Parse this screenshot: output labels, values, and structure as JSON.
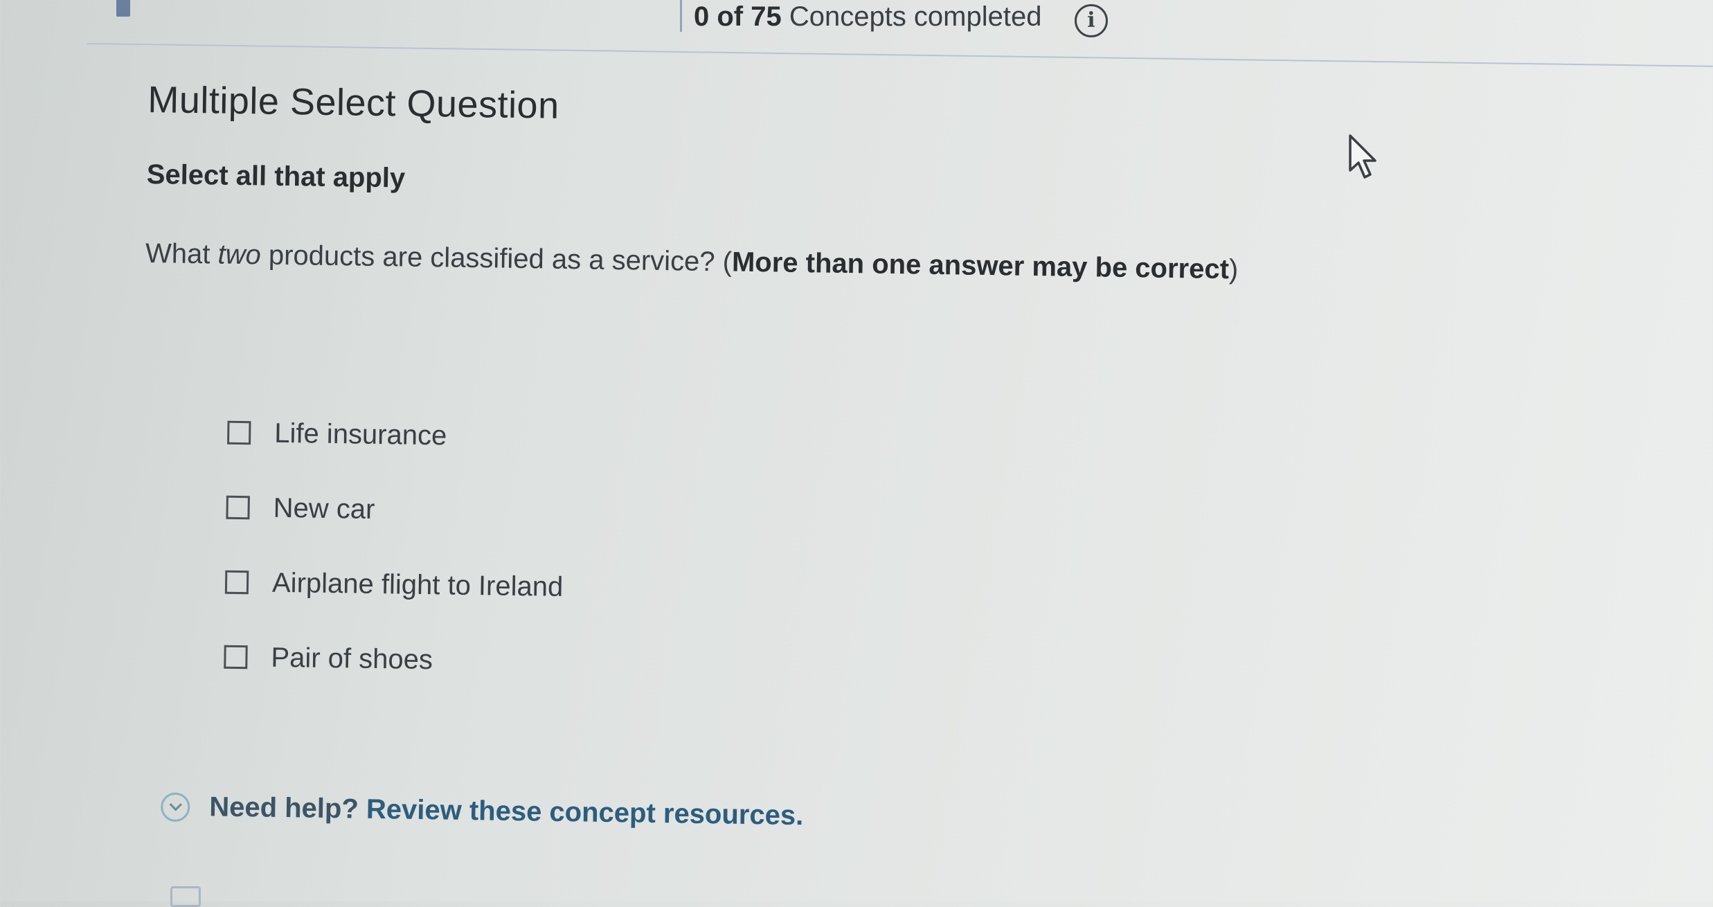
{
  "header": {
    "progress_count": "0 of 75",
    "progress_suffix": " Concepts completed",
    "info_icon_glyph": "i"
  },
  "question": {
    "type_label": "Multiple Select Question",
    "instruction": "Select all that apply",
    "prompt_start": "What ",
    "prompt_emphasis": "two",
    "prompt_middle": " products are classified as a service? (",
    "prompt_bold": "More than one answer may be correct",
    "prompt_end": ")",
    "options": [
      {
        "label": "Life insurance",
        "checked": false
      },
      {
        "label": "New car",
        "checked": false
      },
      {
        "label": "Airplane flight to Ireland",
        "checked": false
      },
      {
        "label": "Pair of shoes",
        "checked": false
      }
    ]
  },
  "help": {
    "lead_text": "Need help?",
    "link_text": " Review these concept resources."
  },
  "colors": {
    "link": "#2d5d7e",
    "text": "#2b2e30",
    "checkbox_border": "#4b5054"
  }
}
